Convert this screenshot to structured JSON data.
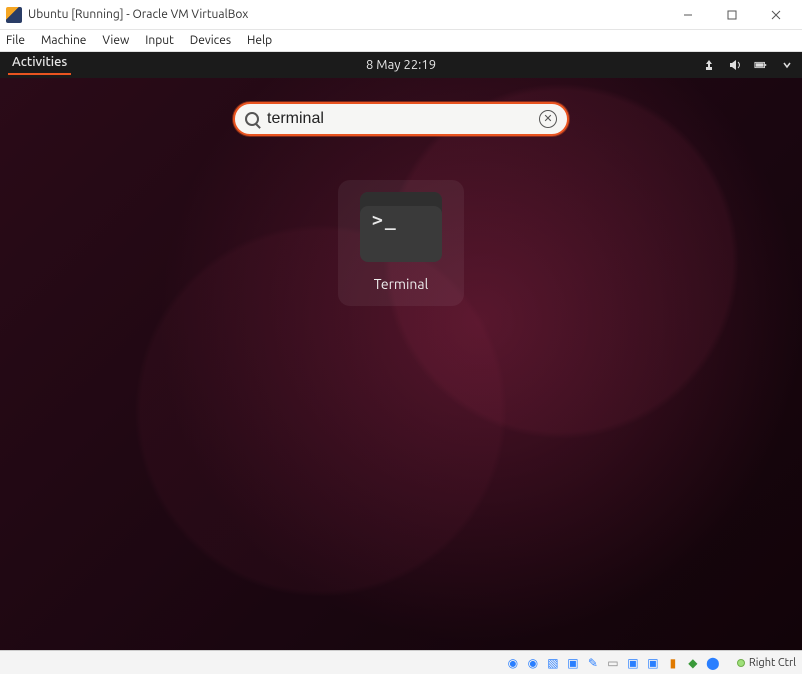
{
  "vb": {
    "title": "Ubuntu [Running] - Oracle VM VirtualBox",
    "menu": {
      "file": "File",
      "machine": "Machine",
      "view": "View",
      "input": "Input",
      "devices": "Devices",
      "help": "Help"
    },
    "status": {
      "hostkey": "Right Ctrl",
      "icons": [
        "disc",
        "disc2",
        "folder",
        "usb",
        "net",
        "display",
        "display2",
        "clipboard",
        "rec",
        "mouse",
        "kb"
      ]
    }
  },
  "guest": {
    "activities_label": "Activities",
    "clock": "8 May  22:19",
    "search_value": "terminal",
    "result_label": "Terminal",
    "top_icons": [
      "network",
      "volume",
      "battery",
      "chevron"
    ]
  }
}
